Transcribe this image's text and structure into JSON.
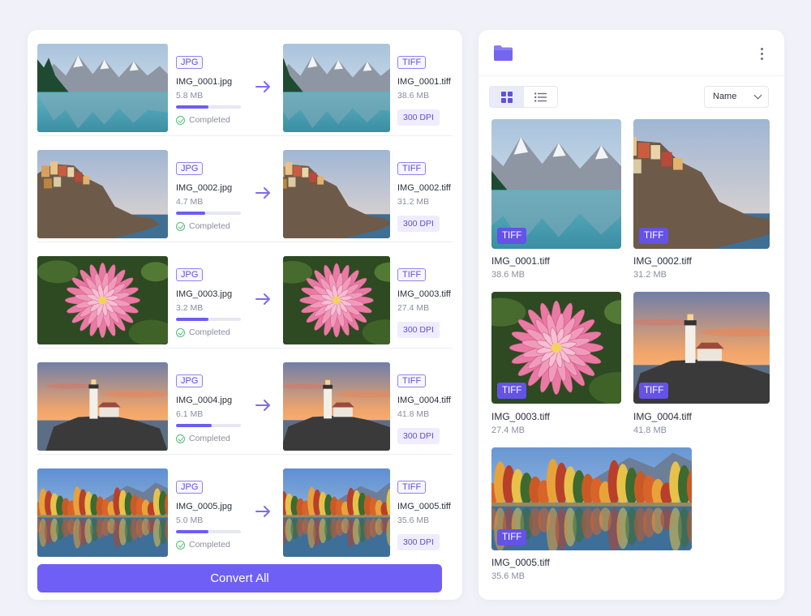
{
  "conversions": [
    {
      "source_format": "JPG",
      "source_name": "IMG_0001.jpg",
      "source_size": "5.8 MB",
      "progress": 0.5,
      "status": "Completed",
      "target_format": "TIFF",
      "target_name": "IMG_0001.tiff",
      "target_size": "38.6 MB",
      "dpi": "300 DPI",
      "scene": "mountain-lake"
    },
    {
      "source_format": "JPG",
      "source_name": "IMG_0002.jpg",
      "source_size": "4.7 MB",
      "progress": 0.45,
      "status": "Completed",
      "target_format": "TIFF",
      "target_name": "IMG_0002.tiff",
      "target_size": "31.2 MB",
      "dpi": "300 DPI",
      "scene": "cliff-village"
    },
    {
      "source_format": "JPG",
      "source_name": "IMG_0003.jpg",
      "source_size": "3.2 MB",
      "progress": 0.5,
      "status": "Completed",
      "target_format": "TIFF",
      "target_name": "IMG_0003.tiff",
      "target_size": "27.4 MB",
      "dpi": "300 DPI",
      "scene": "dahlia"
    },
    {
      "source_format": "JPG",
      "source_name": "IMG_0004.jpg",
      "source_size": "6.1 MB",
      "progress": 0.55,
      "status": "Completed",
      "target_format": "TIFF",
      "target_name": "IMG_0004.tiff",
      "target_size": "41.8 MB",
      "dpi": "300 DPI",
      "scene": "lighthouse"
    },
    {
      "source_format": "JPG",
      "source_name": "IMG_0005.jpg",
      "source_size": "5.0 MB",
      "progress": 0.5,
      "status": "Completed",
      "target_format": "TIFF",
      "target_name": "IMG_0005.tiff",
      "target_size": "35.6 MB",
      "dpi": "300 DPI",
      "scene": "autumn-lake"
    }
  ],
  "convert_button": "Convert All",
  "browser": {
    "sort_label": "Name",
    "files": [
      {
        "badge": "TIFF",
        "name": "IMG_0001.tiff",
        "size": "38.6 MB",
        "scene": "mountain-lake"
      },
      {
        "badge": "TIFF",
        "name": "IMG_0002.tiff",
        "size": "31.2 MB",
        "scene": "cliff-village"
      },
      {
        "badge": "TIFF",
        "name": "IMG_0003.tiff",
        "size": "27.4 MB",
        "scene": "dahlia"
      },
      {
        "badge": "TIFF",
        "name": "IMG_0004.tiff",
        "size": "41.8 MB",
        "scene": "lighthouse"
      },
      {
        "badge": "TIFF",
        "name": "IMG_0005.tiff",
        "size": "35.6 MB",
        "scene": "autumn-lake"
      }
    ]
  },
  "colors": {
    "accent": "#6f5ff5",
    "badge": "#6552e6",
    "success": "#4fbf74"
  }
}
